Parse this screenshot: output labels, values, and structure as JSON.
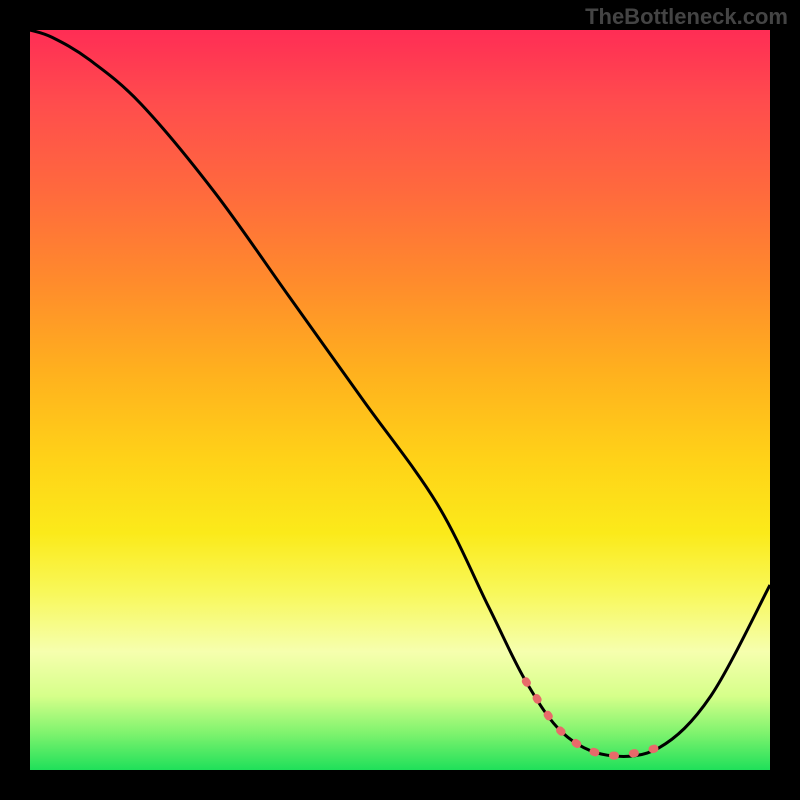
{
  "watermark": "TheBottleneck.com",
  "chart_data": {
    "type": "line",
    "title": "",
    "xlabel": "",
    "ylabel": "",
    "xlim": [
      0,
      100
    ],
    "ylim": [
      0,
      100
    ],
    "series": [
      {
        "name": "curve",
        "x": [
          0,
          3,
          8,
          15,
          25,
          35,
          45,
          55,
          62,
          67,
          72,
          78,
          85,
          92,
          100
        ],
        "values": [
          100,
          99,
          96,
          90,
          78,
          64,
          50,
          36,
          22,
          12,
          5,
          2,
          3,
          10,
          25
        ]
      }
    ],
    "highlight_range_x": [
      63,
      88
    ],
    "optimum_x": 78
  }
}
